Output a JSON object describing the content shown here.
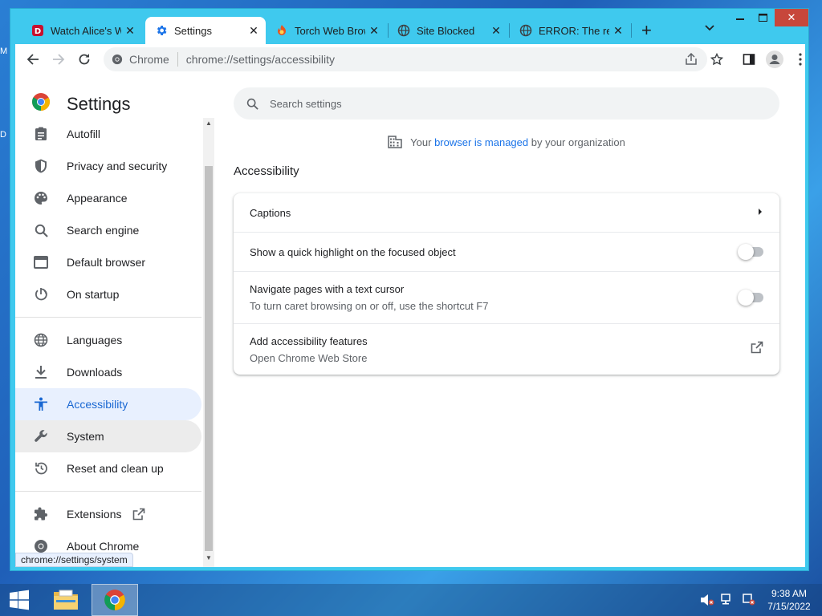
{
  "desktop": {
    "edge_chars": [
      "M",
      "D"
    ]
  },
  "tabs": [
    {
      "title": "Watch Alice's W",
      "icon": "disney-icon",
      "active": false
    },
    {
      "title": "Settings",
      "icon": "gear-icon",
      "active": true
    },
    {
      "title": "Torch Web Brow",
      "icon": "torch-icon",
      "active": false
    },
    {
      "title": "Site Blocked",
      "icon": "globe-icon",
      "active": false
    },
    {
      "title": "ERROR: The req",
      "icon": "globe-icon",
      "active": false
    }
  ],
  "toolbar": {
    "site_label": "Chrome",
    "url": "chrome://settings/accessibility"
  },
  "sidebar": {
    "title": "Settings",
    "items": [
      {
        "label": "Autofill",
        "icon": "clipboard-icon"
      },
      {
        "label": "Privacy and security",
        "icon": "shield-icon"
      },
      {
        "label": "Appearance",
        "icon": "palette-icon"
      },
      {
        "label": "Search engine",
        "icon": "search-icon"
      },
      {
        "label": "Default browser",
        "icon": "browser-icon"
      },
      {
        "label": "On startup",
        "icon": "power-icon"
      },
      {
        "label": "Languages",
        "icon": "globe-icon"
      },
      {
        "label": "Downloads",
        "icon": "download-icon"
      },
      {
        "label": "Accessibility",
        "icon": "accessibility-icon"
      },
      {
        "label": "System",
        "icon": "wrench-icon"
      },
      {
        "label": "Reset and clean up",
        "icon": "restore-icon"
      },
      {
        "label": "Extensions",
        "icon": "puzzle-icon"
      },
      {
        "label": "About Chrome",
        "icon": "chrome-icon"
      }
    ]
  },
  "status_bar_url": "chrome://settings/system",
  "main": {
    "search_placeholder": "Search settings",
    "managed": {
      "prefix": "Your",
      "link": "browser is managed",
      "suffix": "by your organization"
    },
    "section_title": "Accessibility",
    "rows": [
      {
        "label": "Captions",
        "sub": ""
      },
      {
        "label": "Show a quick highlight on the focused object",
        "sub": ""
      },
      {
        "label": "Navigate pages with a text cursor",
        "sub": "To turn caret browsing on or off, use the shortcut F7"
      },
      {
        "label": "Add accessibility features",
        "sub": "Open Chrome Web Store"
      }
    ],
    "toggles": {
      "focus_highlight": false,
      "caret_browsing": false
    }
  },
  "taskbar": {
    "time": "9:38 AM",
    "date": "7/15/2022"
  },
  "colors": {
    "window_frame": "#3fc9ee",
    "accent": "#1a73e8",
    "active_nav_bg": "#e8f0fe"
  }
}
